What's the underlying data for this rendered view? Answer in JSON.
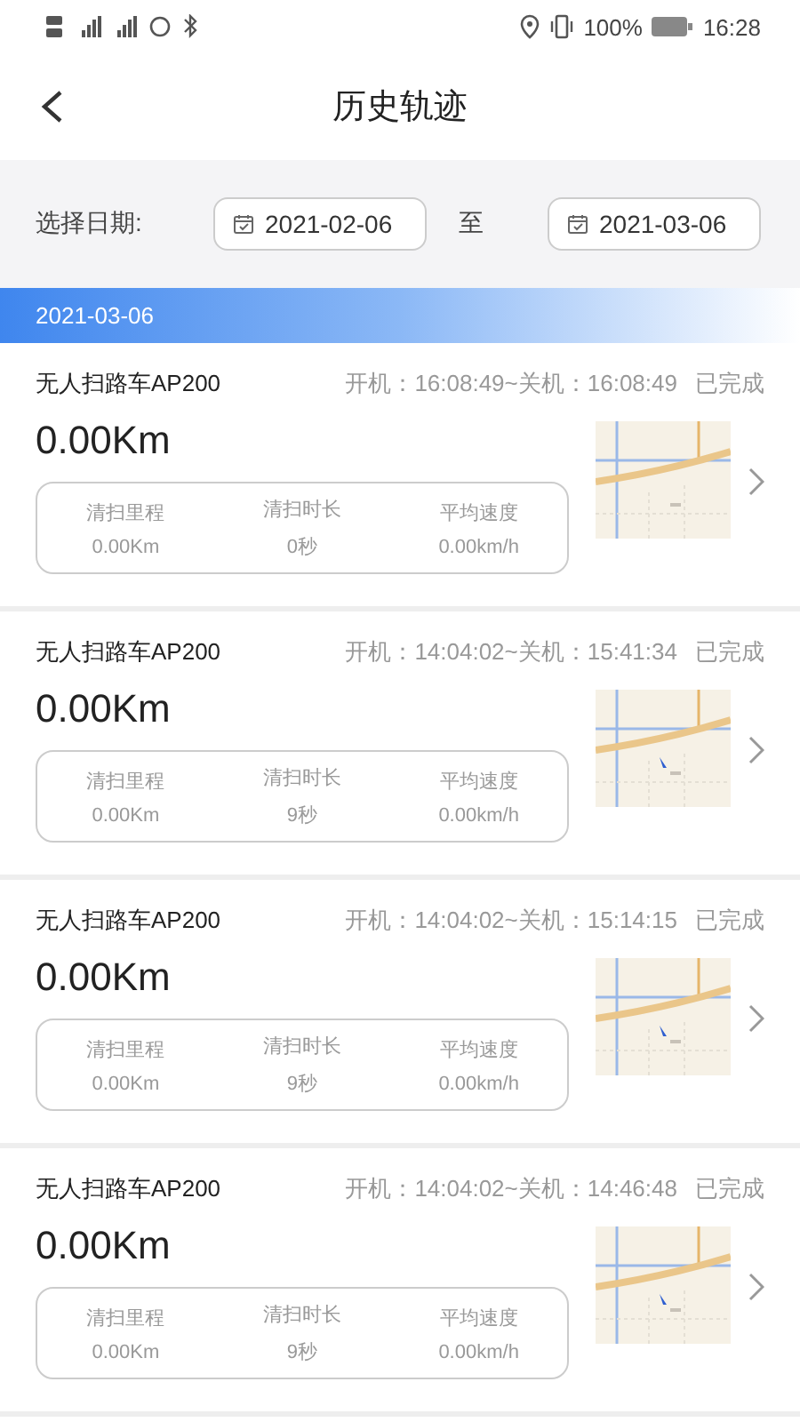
{
  "status_bar": {
    "battery": "100%",
    "time": "16:28"
  },
  "header": {
    "title": "历史轨迹"
  },
  "date_filter": {
    "label": "选择日期:",
    "start": "2021-02-06",
    "separator": "至",
    "end": "2021-03-06"
  },
  "group_date": "2021-03-06",
  "records": [
    {
      "device": "无人扫路车AP200",
      "time_range": "开机：16:08:49~关机：16:08:49",
      "status": "已完成",
      "distance": "0.00Km",
      "stats": [
        {
          "label": "清扫里程",
          "value": "0.00Km"
        },
        {
          "label": "清扫时长",
          "value": "0秒"
        },
        {
          "label": "平均速度",
          "value": "0.00km/h"
        }
      ]
    },
    {
      "device": "无人扫路车AP200",
      "time_range": "开机：14:04:02~关机：15:41:34",
      "status": "已完成",
      "distance": "0.00Km",
      "stats": [
        {
          "label": "清扫里程",
          "value": "0.00Km"
        },
        {
          "label": "清扫时长",
          "value": "9秒"
        },
        {
          "label": "平均速度",
          "value": "0.00km/h"
        }
      ]
    },
    {
      "device": "无人扫路车AP200",
      "time_range": "开机：14:04:02~关机：15:14:15",
      "status": "已完成",
      "distance": "0.00Km",
      "stats": [
        {
          "label": "清扫里程",
          "value": "0.00Km"
        },
        {
          "label": "清扫时长",
          "value": "9秒"
        },
        {
          "label": "平均速度",
          "value": "0.00km/h"
        }
      ]
    },
    {
      "device": "无人扫路车AP200",
      "time_range": "开机：14:04:02~关机：14:46:48",
      "status": "已完成",
      "distance": "0.00Km",
      "stats": [
        {
          "label": "清扫里程",
          "value": "0.00Km"
        },
        {
          "label": "清扫时长",
          "value": "9秒"
        },
        {
          "label": "平均速度",
          "value": "0.00km/h"
        }
      ]
    }
  ]
}
